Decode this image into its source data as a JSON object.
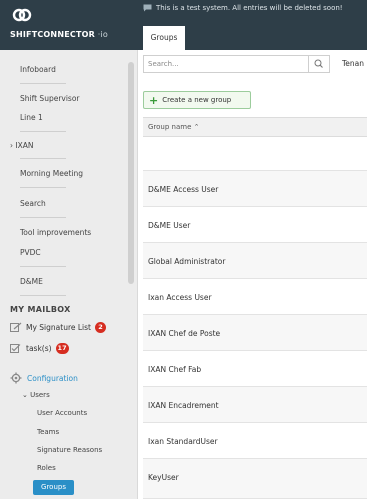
{
  "app": {
    "brand": "SHIFTCONNECTOR",
    "brand_suffix": "io",
    "notice": "This is a test system. All entries will be deleted soon!"
  },
  "tabs": [
    {
      "label": "Groups",
      "active": true
    }
  ],
  "sidebar": {
    "nav_items": [
      {
        "label": "Infoboard"
      },
      {
        "label": "Shift Supervisor"
      },
      {
        "label": "Line 1"
      },
      {
        "label": "IXAN",
        "prefix": "›"
      },
      {
        "label": "Morning Meeting"
      },
      {
        "label": "Search"
      },
      {
        "label": "Tool improvements"
      },
      {
        "label": "PVDC"
      },
      {
        "label": "D&ME"
      }
    ],
    "mailbox": {
      "title": "MY MAILBOX",
      "items": [
        {
          "label": "My Signature List",
          "badge": "2",
          "icon": "signature-icon"
        },
        {
          "label": "task(s)",
          "badge": "17",
          "icon": "task-icon"
        }
      ]
    },
    "configuration": {
      "label": "Configuration",
      "icon": "gear-icon",
      "children": [
        {
          "label": "Users",
          "prefix": "⌄"
        },
        {
          "label": "User Accounts"
        },
        {
          "label": "Teams"
        },
        {
          "label": "Signature Reasons"
        },
        {
          "label": "Roles"
        },
        {
          "label": "Groups",
          "active": true
        }
      ]
    }
  },
  "toolbar": {
    "search_placeholder": "Search...",
    "tenant_label": "Tenan",
    "create_button": "Create a new group"
  },
  "grid": {
    "column_header": "Group name",
    "sort_indicator": "⌃",
    "rows": [
      "D&ME Access User",
      "D&ME User",
      "Global Administrator",
      "Ixan Access User",
      "IXAN Chef de Poste",
      "IXAN Chef Fab",
      "IXAN Encadrement",
      "Ixan StandardUser",
      "KeyUser"
    ]
  },
  "colors": {
    "header_bg": "#2e3e48",
    "accent": "#2a8fc7",
    "badge": "#d62d20",
    "create_green": "#3a9a3a"
  }
}
